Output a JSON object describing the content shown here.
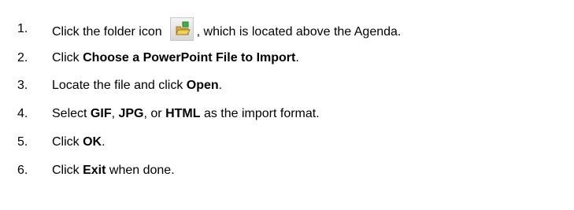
{
  "steps": [
    {
      "number": "1.",
      "before_icon": "Click the folder icon",
      "icon": "folder-open-icon",
      "after_icon": ", which is located above the Agenda."
    },
    {
      "number": "2.",
      "text_1": "Click ",
      "bold_1": "Choose a PowerPoint File to Import",
      "text_2": "."
    },
    {
      "number": "3.",
      "text_1": "Locate the file and click ",
      "bold_1": "Open",
      "text_2": "."
    },
    {
      "number": "4.",
      "text_1": "Select ",
      "bold_1": "GIF",
      "text_2": ", ",
      "bold_2": "JPG",
      "text_3": ", or ",
      "bold_3": "HTML",
      "text_4": " as the import format."
    },
    {
      "number": "5.",
      "text_1": "Click ",
      "bold_1": "OK",
      "text_2": "."
    },
    {
      "number": "6.",
      "text_1": "Click ",
      "bold_1": "Exit",
      "text_2": " when done."
    }
  ],
  "icon_colors": {
    "folder": "#d8b13a",
    "folder_dark": "#9b7a1e",
    "green": "#39b44a"
  }
}
